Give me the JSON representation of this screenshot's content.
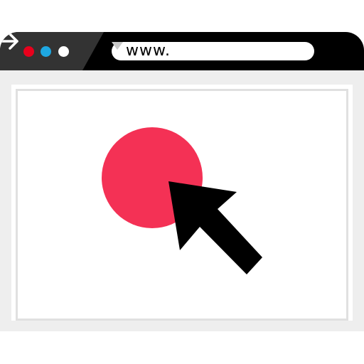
{
  "browser": {
    "window_controls": [
      {
        "name": "close",
        "color": "#e8001c"
      },
      {
        "name": "minimize",
        "color": "#1ea7e1"
      },
      {
        "name": "maximize",
        "color": "#ffffff"
      }
    ],
    "address_bar": {
      "value": "www.",
      "dropdown_icon": "caret-down-icon"
    },
    "go_button_icon": "arrow-right-icon",
    "titlebar_color": "#000000",
    "titlebar_accent_color": "#333333",
    "frame_color": "#eeeeee"
  },
  "content": {
    "shapes": [
      {
        "name": "red-circle",
        "color": "#f43155"
      },
      {
        "name": "mouse-pointer-icon",
        "color": "#000000"
      }
    ]
  }
}
